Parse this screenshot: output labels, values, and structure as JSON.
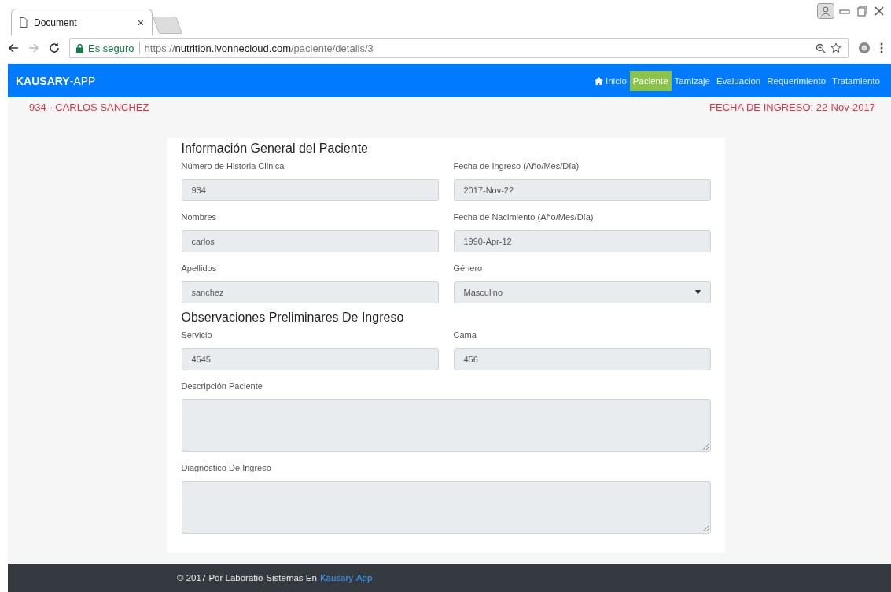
{
  "browser": {
    "tab_title": "Document",
    "tab_close": "×",
    "secure_label": "Es seguro",
    "url": {
      "scheme": "https://",
      "host": "nutrition.ivonnecloud.com",
      "path": "/paciente/details/3"
    }
  },
  "navbar": {
    "brand": "**KAUSARY**-APP",
    "items": [
      {
        "label": "Inicio",
        "kind": "home",
        "selected": false
      },
      {
        "label": "Paciente",
        "kind": "plain",
        "selected": true
      },
      {
        "label": "Tamizaje",
        "kind": "plain",
        "selected": false
      },
      {
        "label": "Evaluacion",
        "kind": "plain",
        "selected": false
      },
      {
        "label": "Requerimiento",
        "kind": "plain",
        "selected": false
      },
      {
        "label": "Tratamiento",
        "kind": "plain",
        "selected": false
      }
    ]
  },
  "header": {
    "patient": "934 - CARLOS SANCHEZ",
    "admission": "FECHA DE INGRESO: 22-Nov-2017"
  },
  "sections": [
    {
      "title": "Información General del Paciente",
      "fields": [
        {
          "label": "Número de Historia Clinica",
          "value": "934",
          "kind": "input"
        },
        {
          "label": "Fecha de Ingreso (Año/Mes/Día)",
          "value": "2017-Nov-22",
          "kind": "input"
        },
        {
          "label": "Nombres",
          "value": "carlos",
          "kind": "input"
        },
        {
          "label": "Fecha de Nacimiento (Año/Mes/Día)",
          "value": "1990-Apr-12",
          "kind": "input"
        },
        {
          "label": "Apellidos",
          "value": "sanchez",
          "kind": "input"
        },
        {
          "label": "Género",
          "value": "Masculino",
          "kind": "select"
        }
      ]
    },
    {
      "title": "Observaciones Preliminares De Ingreso",
      "fields": [
        {
          "label": "Servicio",
          "value": "4545",
          "kind": "input"
        },
        {
          "label": "Cama",
          "value": "456",
          "kind": "input"
        },
        {
          "label": "Descripción Paciente",
          "kind": "textarea"
        },
        {
          "label": "Diagnóstico De Ingreso",
          "kind": "textarea"
        }
      ]
    }
  ],
  "footer": {
    "text": "© 2017 Por Laboratio-Sistemas En",
    "link": "Kausary-App"
  }
}
